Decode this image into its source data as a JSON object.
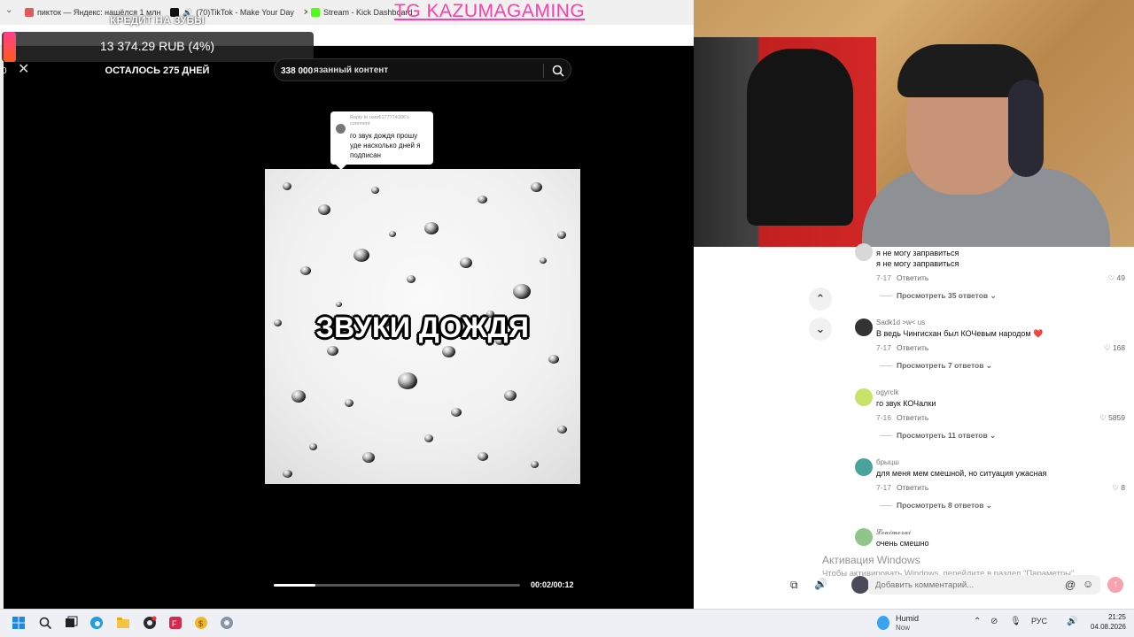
{
  "browser": {
    "tabs": [
      {
        "label": "пикток — Яндекс: нашёлся 1 млн",
        "color": "#e05a5a"
      },
      {
        "label": "(70)TikTok - Make Your Day",
        "color": "#111111"
      },
      {
        "label": "Stream - Kick Dashboard",
        "color": "#53fc18"
      }
    ],
    "overlay_title": "TG KAZUMAGAMING"
  },
  "donation": {
    "title": "КРЕДИТ НА ЗУБЫ",
    "amount": "13 374.29 RUB (4%)",
    "remaining": "ОСТАЛОСЬ 275 ДНЕЙ",
    "progress_percent": 4,
    "leading_zero": "0"
  },
  "search": {
    "count": "338 000",
    "placeholder": "язанный контент"
  },
  "reply_bubble": {
    "reply_to": "Reply to user6177774306's comment",
    "text": "го звук дождя прошу уде насколько дней я подписан"
  },
  "video": {
    "caption": "ЗВУКИ ДОЖДЯ",
    "time": "00:02/00:12",
    "progress_fraction": 0.17
  },
  "comments": [
    {
      "user": "",
      "text": "я не могу заправиться\nя не могу заправиться",
      "date": "7-17",
      "reply": "Ответить",
      "likes": "49",
      "more": "Просмотреть 35 ответов",
      "avatar_color": "#d8d8d8"
    },
    {
      "user": "Sadk1d >w< us",
      "text": "В ведь Чингисхан был КОЧевым народом ❤️",
      "date": "7-17",
      "reply": "Ответить",
      "likes": "168",
      "more": "Просмотреть 7 ответов",
      "avatar_color": "#333333"
    },
    {
      "user": "ogyrclk",
      "text": "го звук КОЧалки",
      "date": "7-16",
      "reply": "Ответить",
      "likes": "5859",
      "more": "Просмотреть 11 ответов",
      "avatar_color": "#c8e26a"
    },
    {
      "user": "брыцш",
      "text": "для меня мем смешной, но ситуация ужасная",
      "date": "7-17",
      "reply": "Ответить",
      "likes": "8",
      "more": "Просмотреть 8 ответов",
      "avatar_color": "#4aa39a"
    },
    {
      "user": "𝓛𝓸𝓪𝓲𝓶𝓸𝓻𝓪𝓲",
      "text": "очень смешно",
      "date": "",
      "reply": "",
      "likes": "",
      "more": "",
      "avatar_color": "#8fc48a"
    }
  ],
  "activation": {
    "title": "Активация Windows",
    "subtitle": "Чтобы активировать Windows, перейдите в раздел \"Параметры\"."
  },
  "comment_input": {
    "placeholder": "Добавить комментарий..."
  },
  "taskbar": {
    "weather_title": "Humid",
    "weather_sub": "Now",
    "lang": "РУС",
    "time": "21:25",
    "date": "04.08.2026"
  }
}
